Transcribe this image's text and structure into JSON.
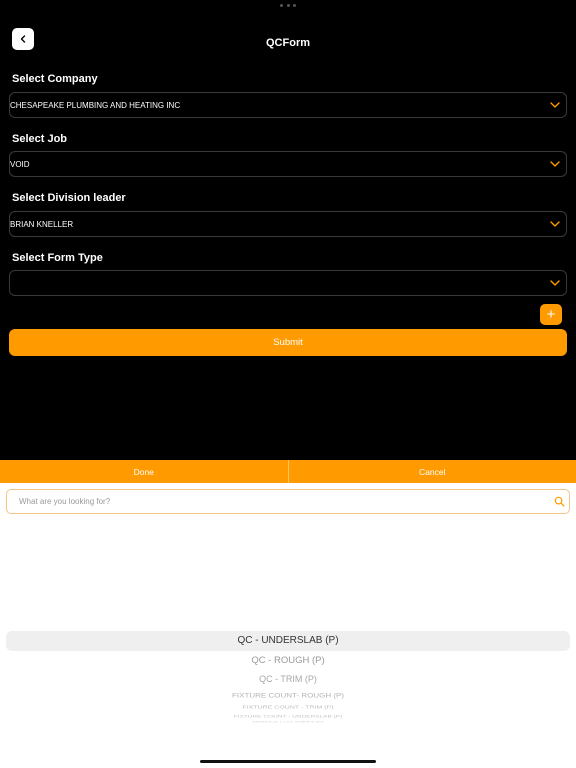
{
  "header": {
    "title": "QCForm"
  },
  "form": {
    "company": {
      "label": "Select Company",
      "value": "CHESAPEAKE PLUMBING AND HEATING INC"
    },
    "job": {
      "label": "Select Job",
      "value": "VOID"
    },
    "division_leader": {
      "label": "Select Division leader",
      "value": "BRIAN KNELLER"
    },
    "form_type": {
      "label": "Select Form Type",
      "value": ""
    },
    "add_label": "+",
    "submit_label": "Submit"
  },
  "picker": {
    "done_label": "Done",
    "cancel_label": "Cancel",
    "search_placeholder": "What are you looking for?",
    "options": [
      "QC - UNDERSLAB (P)",
      "QC - ROUGH (P)",
      "QC - TRIM (P)",
      "FIXTURE COUNT- ROUGH (P)",
      "FIXTURE COUNT - TRIM (P)",
      "FIXTURE COUNT - UNDERSLAB (P)",
      "SERVICE LOG SHEET (P)"
    ]
  },
  "colors": {
    "accent": "#ff9a00",
    "background": "#000000",
    "sheet": "#ffffff"
  },
  "icons": {
    "back": "chevron-left-icon",
    "dropdown": "chevron-down-icon",
    "search": "search-icon",
    "add": "plus-icon"
  }
}
